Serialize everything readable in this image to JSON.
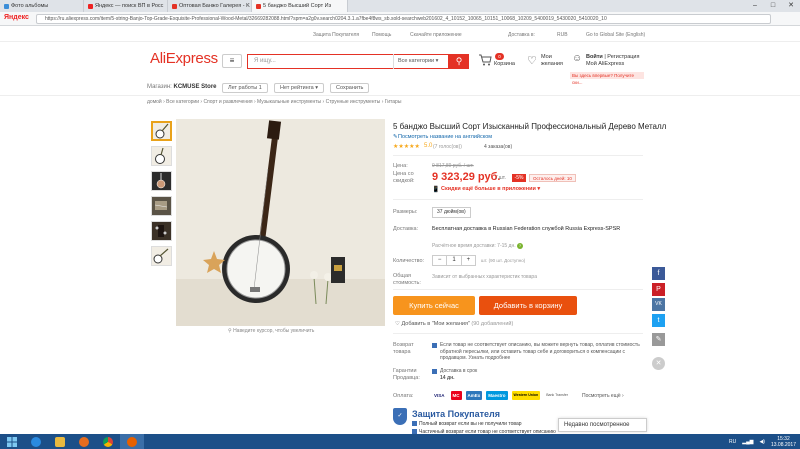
{
  "browser": {
    "tabs": [
      {
        "label": "Фото альбомы",
        "active": false,
        "color": "#3b8ed8"
      },
      {
        "label": "Яндекс — поиск ВП в Росс",
        "active": false,
        "color": "#e22"
      },
      {
        "label": "Оптовая Банжо Галерея - K",
        "active": false,
        "color": "#e43225"
      },
      {
        "label": "5 банджо Высший Сорт Из",
        "active": true,
        "color": "#e43225"
      }
    ],
    "yandex_label": "Яндекс",
    "url": "https://ru.aliexpress.com/item/5-string-Banjo-Top-Grade-Exquisite-Professional-Wood-Metal/32669282088.html?spm=a2g0v.search0204.3.1.a7fbe4f8ws_sb.sold-searchweb201602_4_10152_10065_10151_10068_10209_5400019_5430020_5410020_10"
  },
  "topnav": {
    "items": [
      "Защита Покупателя",
      "Помощь",
      "Скачайте приложение",
      "Доставка в:",
      "RUB",
      "Go to Global Site (English)"
    ]
  },
  "header": {
    "logo": "AliExpress",
    "cat_icon": "menu-icon",
    "search_placeholder": "Я ищу...",
    "search_category": "Все категории",
    "cart_count": "0",
    "cart_label": "Корзина",
    "wish_label1": "Мои",
    "wish_label2": "желания",
    "account_login": "Войти",
    "account_register": "Регистрация",
    "account_my": "Мой AliExpress",
    "coupon": "Вы здесь впервые? Получите ски..."
  },
  "store": {
    "label": "Магазин:",
    "name": "KCMUSE Store",
    "btn1": "Лет работы 1",
    "btn2": "Нет рейтинга",
    "btn3": "Сохранить"
  },
  "breadcrumb": "домой › Все категории › Спорт и развлечения › Музыкальные инструменты › Струнные инструменты › Гитары",
  "product": {
    "title": "5 банджо Высший Сорт Изысканный Профессиональный Дерево Металл",
    "english_link": "Посмотреть название на английском",
    "stars": "★★★★★",
    "rating": "5.0",
    "reviews": "(7 голос(ов))",
    "orders": "4 заказа(ов)",
    "price_label": "Цена:",
    "old_price": "9 817,89 руб. / шт.",
    "sale_label1": "Цена со",
    "sale_label2": "скидкой:",
    "price": "9 323,29 руб.",
    "unit": "/ шт.",
    "discount": "-5%",
    "timer": "Осталось дней: 10",
    "cheaper": "Скидки ещё больше в приложении",
    "size_label": "Размеры:",
    "size_value": "37 дюйм(ов)",
    "delivery_label": "Доставка:",
    "delivery_line1": "Бесплатная доставка в Russian Federation службой Russia Express-SPSR",
    "delivery_line2": "",
    "delivery_time": "Расчётное время доставки: 7-15 дн.",
    "qty_label": "Количество:",
    "qty_value": "1",
    "qty_available": "шт. (90 шт. Доступно)",
    "total_label1": "Общая",
    "total_label2": "стоимость:",
    "total_value": "Зависит от выбранных характеристик товара",
    "buy_now": "Купить сейчас",
    "add_to_cart": "Добавить в корзину",
    "add_wish": "Добавить в \"Мои желания\"",
    "wish_count": "(90 добавлений)",
    "zoom_tip": "Наведите курсор, чтобы увеличить",
    "return_label1": "Возврат",
    "return_label2": "товара",
    "return_text": "Если товар не соответствует описанию, вы можете вернуть товар, оплатив стоимость обратной пересылки, или оставить товар себе и договориться о компенсации с продавцом. Узнать подробнее",
    "guarantee_label1": "Гарантии",
    "guarantee_label2": "Продавца:",
    "guarantee_text1": "Доставка в срок",
    "guarantee_text2": "14 дн.",
    "payment_label": "Оплата:",
    "payment_methods": [
      "VISA",
      "MC",
      "AmEx",
      "Maestro",
      "Western Union",
      "Bank Transfer"
    ],
    "payment_more": "Посмотреть ещё ›",
    "protection_title": "Защита Покупателя",
    "protection1": "Полный возврат если вы не получили товар",
    "protection2": "Частичный возврат если товар не соответствует описанию"
  },
  "recently_viewed": "Недавно посмотренное",
  "social": [
    "f",
    "P",
    "VK",
    "t",
    "✎",
    "✕"
  ],
  "taskbar": {
    "lang": "RU",
    "time": "15:32",
    "date": "13.08.2017"
  },
  "colors": {
    "accent": "#e43225",
    "buy": "#f7941d",
    "cart": "#e9500e",
    "taskbar": "#1c4f88"
  }
}
